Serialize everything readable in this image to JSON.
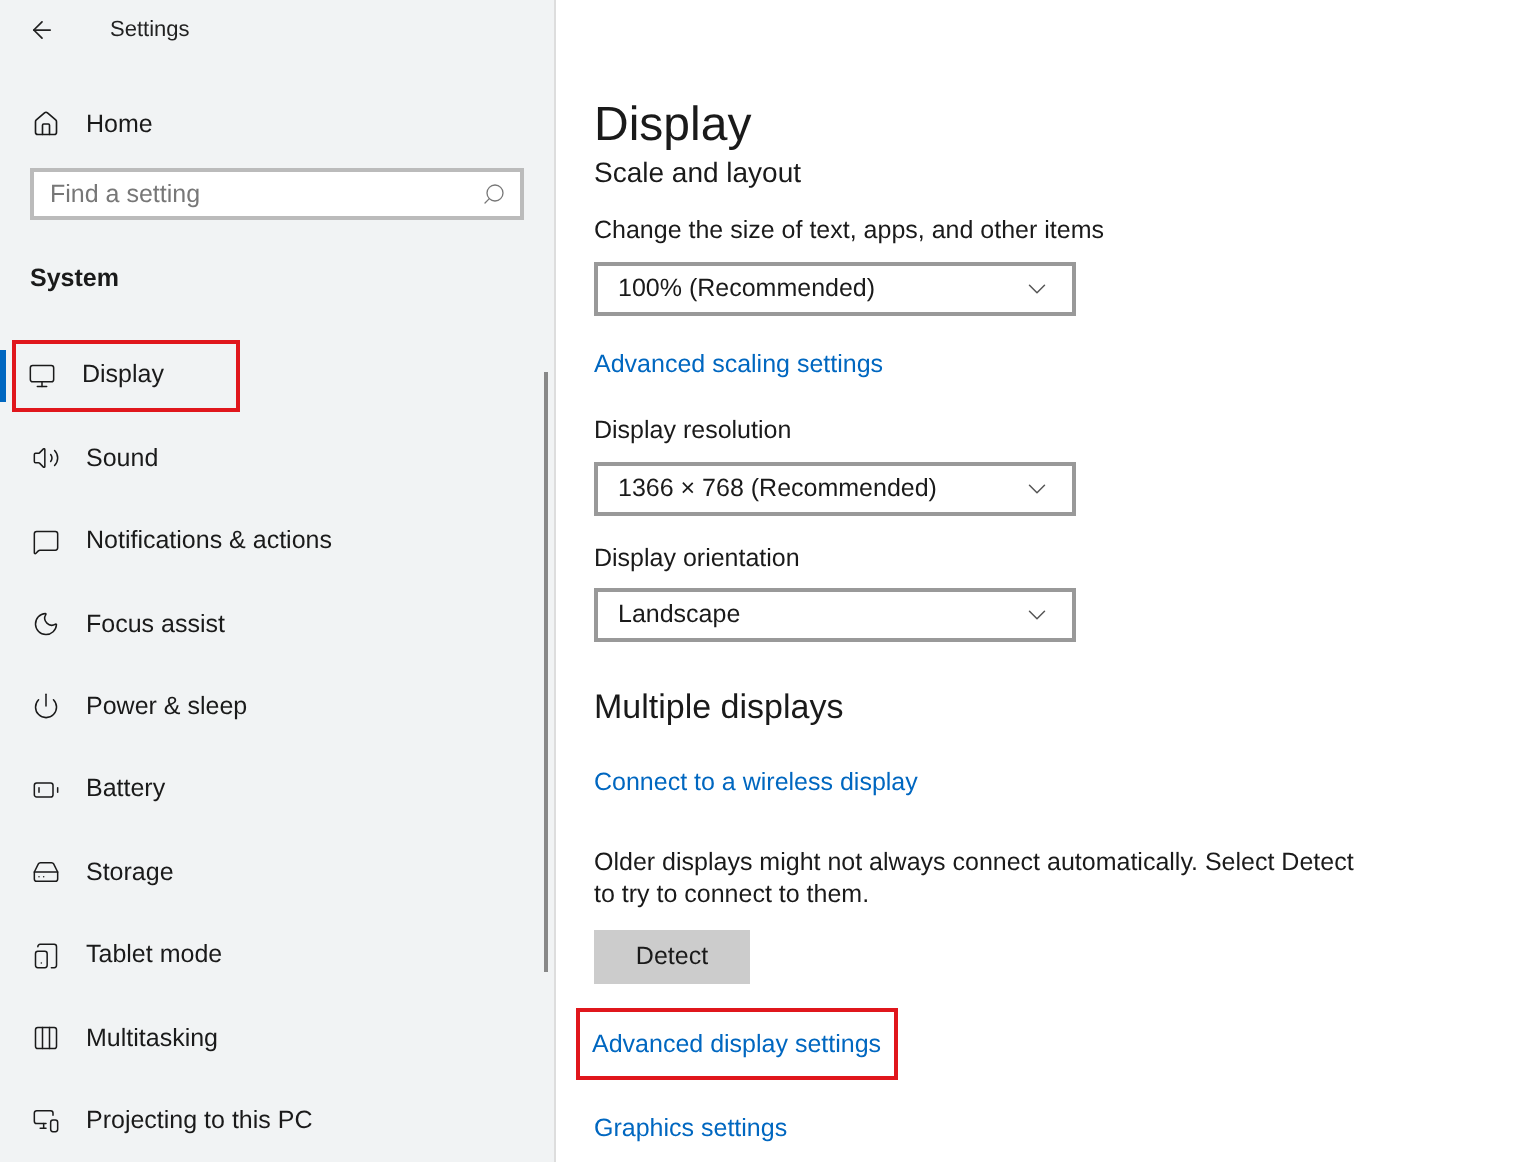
{
  "window": {
    "title": "Settings"
  },
  "home": {
    "label": "Home"
  },
  "search": {
    "placeholder": "Find a setting"
  },
  "section": "System",
  "sidebar": {
    "items": [
      {
        "label": "Display",
        "selected": true,
        "highlighted": true
      },
      {
        "label": "Sound",
        "selected": false,
        "highlighted": false
      },
      {
        "label": "Notifications & actions",
        "selected": false,
        "highlighted": false
      },
      {
        "label": "Focus assist",
        "selected": false,
        "highlighted": false
      },
      {
        "label": "Power & sleep",
        "selected": false,
        "highlighted": false
      },
      {
        "label": "Battery",
        "selected": false,
        "highlighted": false
      },
      {
        "label": "Storage",
        "selected": false,
        "highlighted": false
      },
      {
        "label": "Tablet mode",
        "selected": false,
        "highlighted": false
      },
      {
        "label": "Multitasking",
        "selected": false,
        "highlighted": false
      },
      {
        "label": "Projecting to this PC",
        "selected": false,
        "highlighted": false
      }
    ]
  },
  "page": {
    "title": "Display",
    "subtitle": "Scale and layout",
    "content": [
      {
        "kind": "label",
        "text": "Change the size of text, apps, and other items"
      },
      {
        "kind": "dropdown",
        "value": "100% (Recommended)"
      },
      {
        "kind": "link",
        "text": "Advanced scaling settings",
        "highlighted": false
      },
      {
        "kind": "label",
        "text": "Display resolution"
      },
      {
        "kind": "dropdown",
        "value": "1366 × 768 (Recommended)"
      },
      {
        "kind": "label",
        "text": "Display orientation"
      },
      {
        "kind": "dropdown",
        "value": "Landscape"
      },
      {
        "kind": "heading",
        "text": "Multiple displays"
      },
      {
        "kind": "link",
        "text": "Connect to a wireless display",
        "highlighted": false
      },
      {
        "kind": "paragraph",
        "text": "Older displays might not always connect automatically. Select Detect to try to connect to them."
      },
      {
        "kind": "button",
        "text": "Detect"
      },
      {
        "kind": "link",
        "text": "Advanced display settings",
        "highlighted": true
      },
      {
        "kind": "link",
        "text": "Graphics settings",
        "highlighted": false
      }
    ]
  }
}
